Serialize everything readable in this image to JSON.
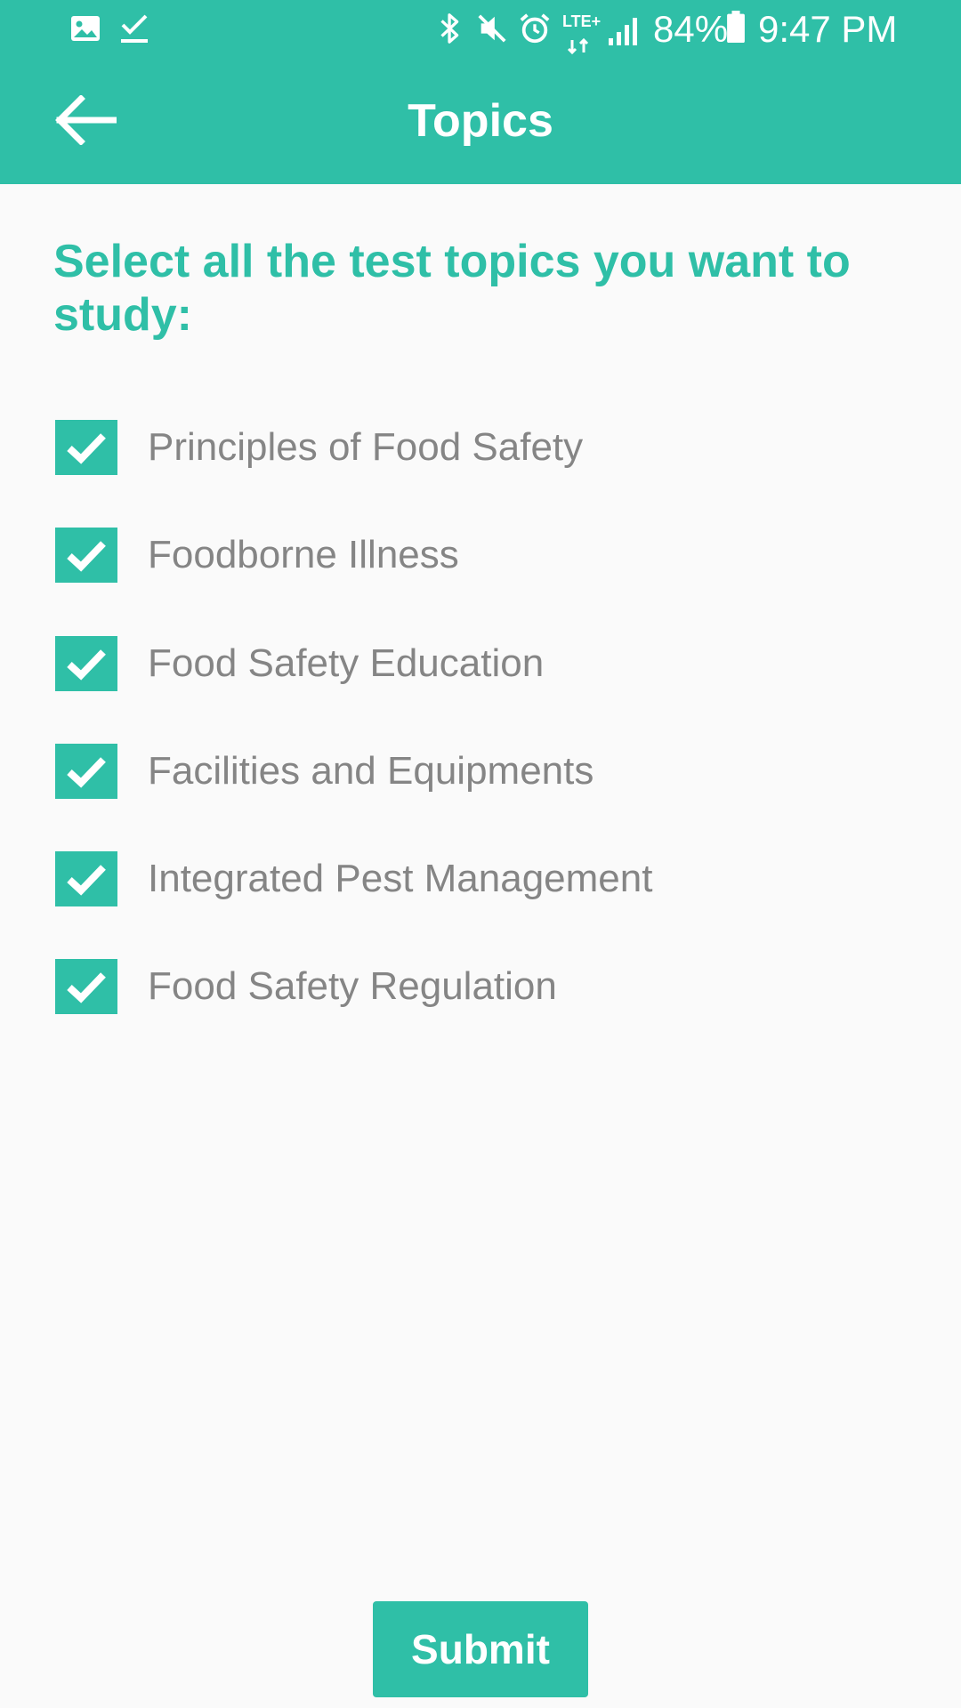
{
  "status_bar": {
    "battery_percent": "84%",
    "time": "9:47 PM",
    "network": "LTE+",
    "icons": [
      "image-icon",
      "download-done-icon",
      "bluetooth-icon",
      "mute-icon",
      "alarm-icon",
      "lte-data-icon",
      "signal-icon",
      "battery-icon"
    ]
  },
  "app_bar": {
    "title": "Topics",
    "back_icon": "arrow-back-icon"
  },
  "main": {
    "prompt": "Select all the test topics you want to study:",
    "topics": [
      {
        "label": "Principles of Food Safety",
        "checked": true
      },
      {
        "label": "Foodborne Illness",
        "checked": true
      },
      {
        "label": "Food Safety Education",
        "checked": true
      },
      {
        "label": "Facilities and Equipments",
        "checked": true
      },
      {
        "label": "Integrated Pest Management",
        "checked": true
      },
      {
        "label": "Food Safety Regulation",
        "checked": true
      }
    ],
    "submit_label": "Submit"
  },
  "colors": {
    "accent": "#2fbfa7",
    "background": "#fafafa",
    "topic_text": "#858585"
  }
}
